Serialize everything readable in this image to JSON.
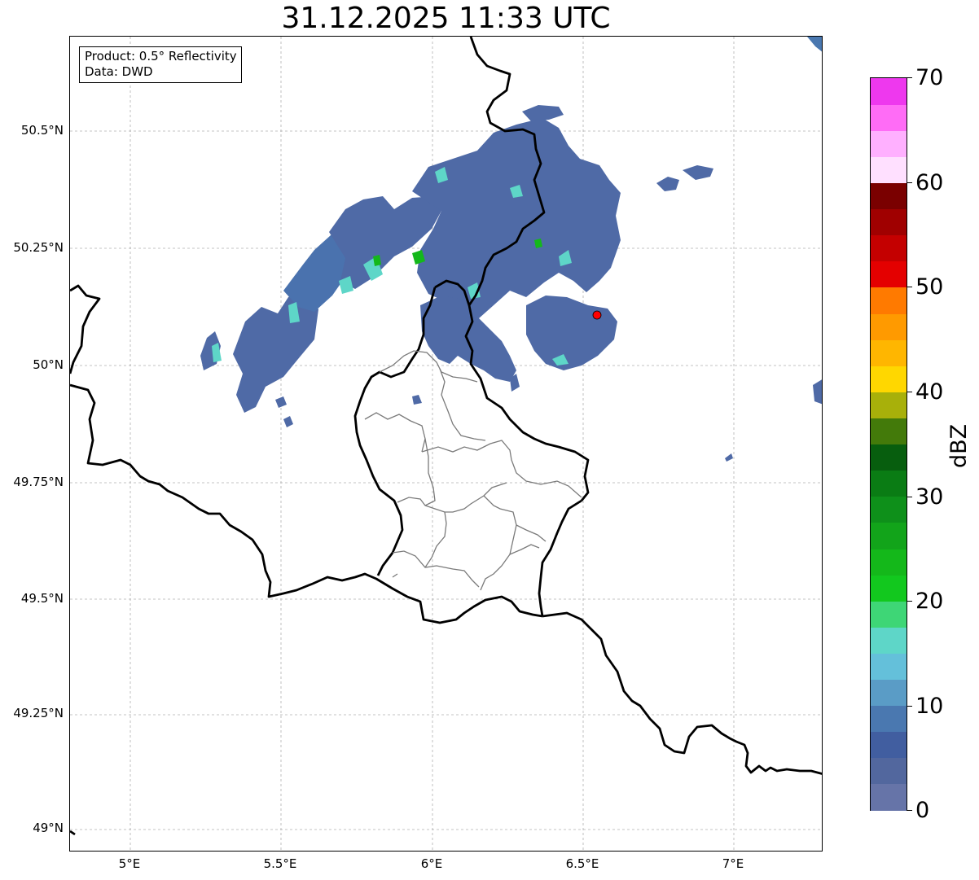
{
  "title": "31.12.2025 11:33 UTC",
  "info_box": {
    "product": "Product: 0.5° Reflectivity",
    "data": "Data: DWD"
  },
  "map": {
    "lat_labels": [
      "50.5°N",
      "50.25°N",
      "50°N",
      "49.75°N",
      "49.5°N",
      "49.25°N",
      "49°N"
    ],
    "lon_labels": [
      "5°E",
      "5.5°E",
      "6°E",
      "6.5°E",
      "7°E"
    ],
    "extent": {
      "lon_min": 4.8,
      "lon_max": 7.3,
      "lat_min": 48.95,
      "lat_max": 50.7
    },
    "gridlines": true,
    "marker": {
      "name": "radar-site",
      "lon": 6.55,
      "lat": 50.11,
      "color": "#ff0000"
    }
  },
  "colorbar": {
    "label": "dBZ",
    "ticks": [
      "0",
      "10",
      "20",
      "30",
      "40",
      "50",
      "60",
      "70"
    ],
    "min": 0,
    "max": 70,
    "step": 2.5,
    "colors": [
      "#6674a8",
      "#52679e",
      "#415ea0",
      "#4a78b0",
      "#5a9cc6",
      "#64c0da",
      "#5ed6c8",
      "#3ed676",
      "#12c81e",
      "#14b81a",
      "#12a41a",
      "#0e901a",
      "#0a7c14",
      "#075e0e",
      "#437a0a",
      "#a8b00a",
      "#ffd700",
      "#ffb600",
      "#ff9a00",
      "#ff7a00",
      "#e40000",
      "#c40000",
      "#a00000",
      "#7a0000",
      "#ffe0ff",
      "#ffb0ff",
      "#ff6cf6",
      "#ee38ee"
    ]
  }
}
